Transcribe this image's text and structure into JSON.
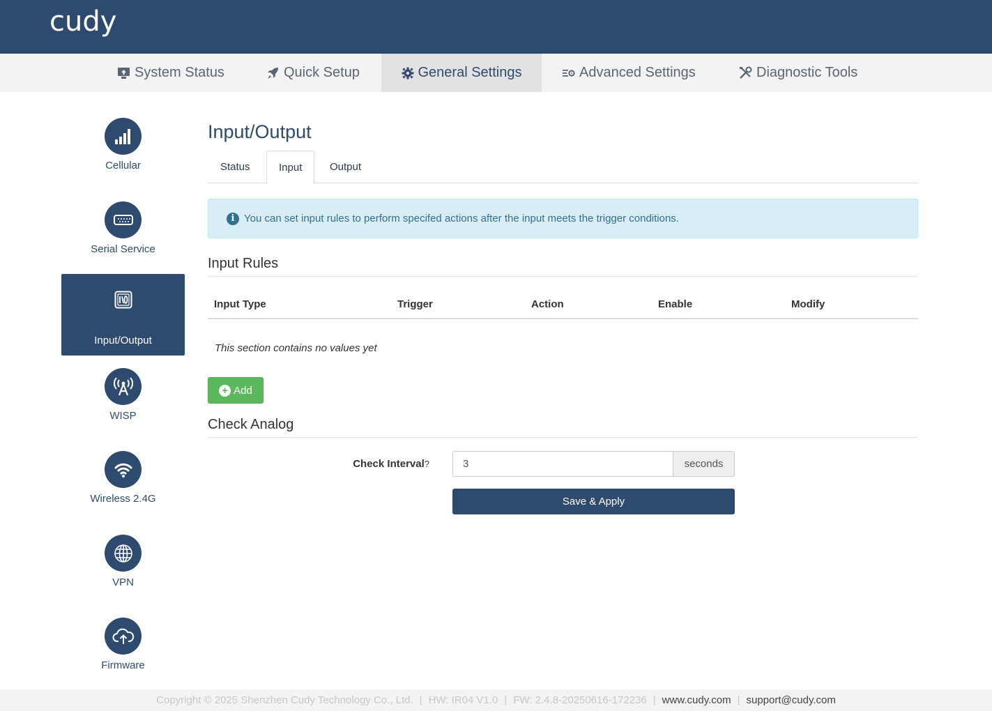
{
  "brand": {
    "logo": "cudy"
  },
  "nav": [
    {
      "label": "System Status",
      "icon": "monitor-upload-icon"
    },
    {
      "label": "Quick Setup",
      "icon": "rocket-icon"
    },
    {
      "label": "General Settings",
      "icon": "gear-icon",
      "active": true
    },
    {
      "label": "Advanced Settings",
      "icon": "sliders-gear-icon"
    },
    {
      "label": "Diagnostic Tools",
      "icon": "wrench-screwdriver-icon"
    }
  ],
  "sidebar": [
    {
      "label": "Cellular",
      "icon": "signal-bars-icon"
    },
    {
      "label": "Serial Service",
      "icon": "serial-port-icon"
    },
    {
      "label": "Input/Output",
      "icon": "io-icon",
      "active": true
    },
    {
      "label": "WISP",
      "icon": "antenna-icon"
    },
    {
      "label": "Wireless 2.4G",
      "icon": "wifi-icon"
    },
    {
      "label": "VPN",
      "icon": "globe-icon"
    },
    {
      "label": "Firmware",
      "icon": "cloud-upload-icon"
    }
  ],
  "page": {
    "title": "Input/Output",
    "tabs": [
      {
        "label": "Status"
      },
      {
        "label": "Input",
        "active": true
      },
      {
        "label": "Output"
      }
    ],
    "alert": "You can set input rules to perform specifed actions after the input meets the trigger conditions.",
    "input_rules": {
      "title": "Input Rules",
      "columns": [
        "Input Type",
        "Trigger",
        "Action",
        "Enable",
        "Modify"
      ],
      "empty_text": "This section contains no values yet",
      "add_label": "Add"
    },
    "check_analog": {
      "title": "Check Analog",
      "interval_label": "Check Interval",
      "help_glyph": "?",
      "interval_value": "3",
      "interval_unit": "seconds",
      "save_label": "Save & Apply"
    }
  },
  "footer": {
    "copyright": "Copyright © 2025 Shenzhen Cudy Technology Co., Ltd.",
    "hw": "HW: IR04 V1.0",
    "fw": "FW: 2.4.8-20250616-172236",
    "website": "www.cudy.com",
    "email": "support@cudy.com"
  },
  "colors": {
    "primary": "#2e4a6e",
    "success": "#5cb85c",
    "info_bg": "#d9edf7",
    "info_text": "#31708f"
  }
}
